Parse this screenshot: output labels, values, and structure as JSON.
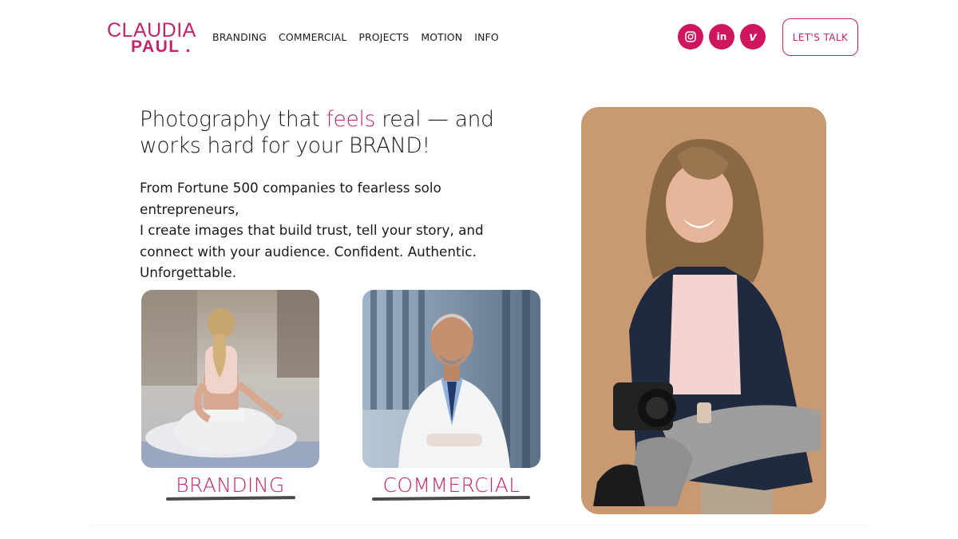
{
  "brand": {
    "line1": "CLAUDIA",
    "line2": "PAUL .",
    "accent_color": "#c4256a",
    "social_color": "#d0155f"
  },
  "nav": {
    "items": [
      {
        "label": "BRANDING"
      },
      {
        "label": "COMMERCIAL"
      },
      {
        "label": "PROJECTS"
      },
      {
        "label": "MOTION"
      },
      {
        "label": "INFO"
      }
    ]
  },
  "social": {
    "items": [
      {
        "icon": "instagram-icon"
      },
      {
        "icon": "linkedin-icon",
        "text": "in"
      },
      {
        "icon": "vimeo-icon",
        "text": "v"
      }
    ]
  },
  "cta": {
    "label": "LET'S TALK"
  },
  "hero": {
    "headline_part1": "Photography that ",
    "headline_accent": "feels",
    "headline_part2": " real — and works hard for your BRAND!",
    "intro_lines": [
      "From Fortune 500 companies to fearless solo",
      "entrepreneurs,",
      "I create images that build trust, tell your story, and",
      "connect with your audience. Confident. Authentic.",
      "Unforgettable."
    ]
  },
  "tiles": [
    {
      "label": "BRANDING",
      "image": "yoga-woman-photo"
    },
    {
      "label": "COMMERCIAL",
      "image": "doctor-portrait-photo"
    }
  ],
  "portrait": {
    "image": "photographer-portrait-photo"
  }
}
